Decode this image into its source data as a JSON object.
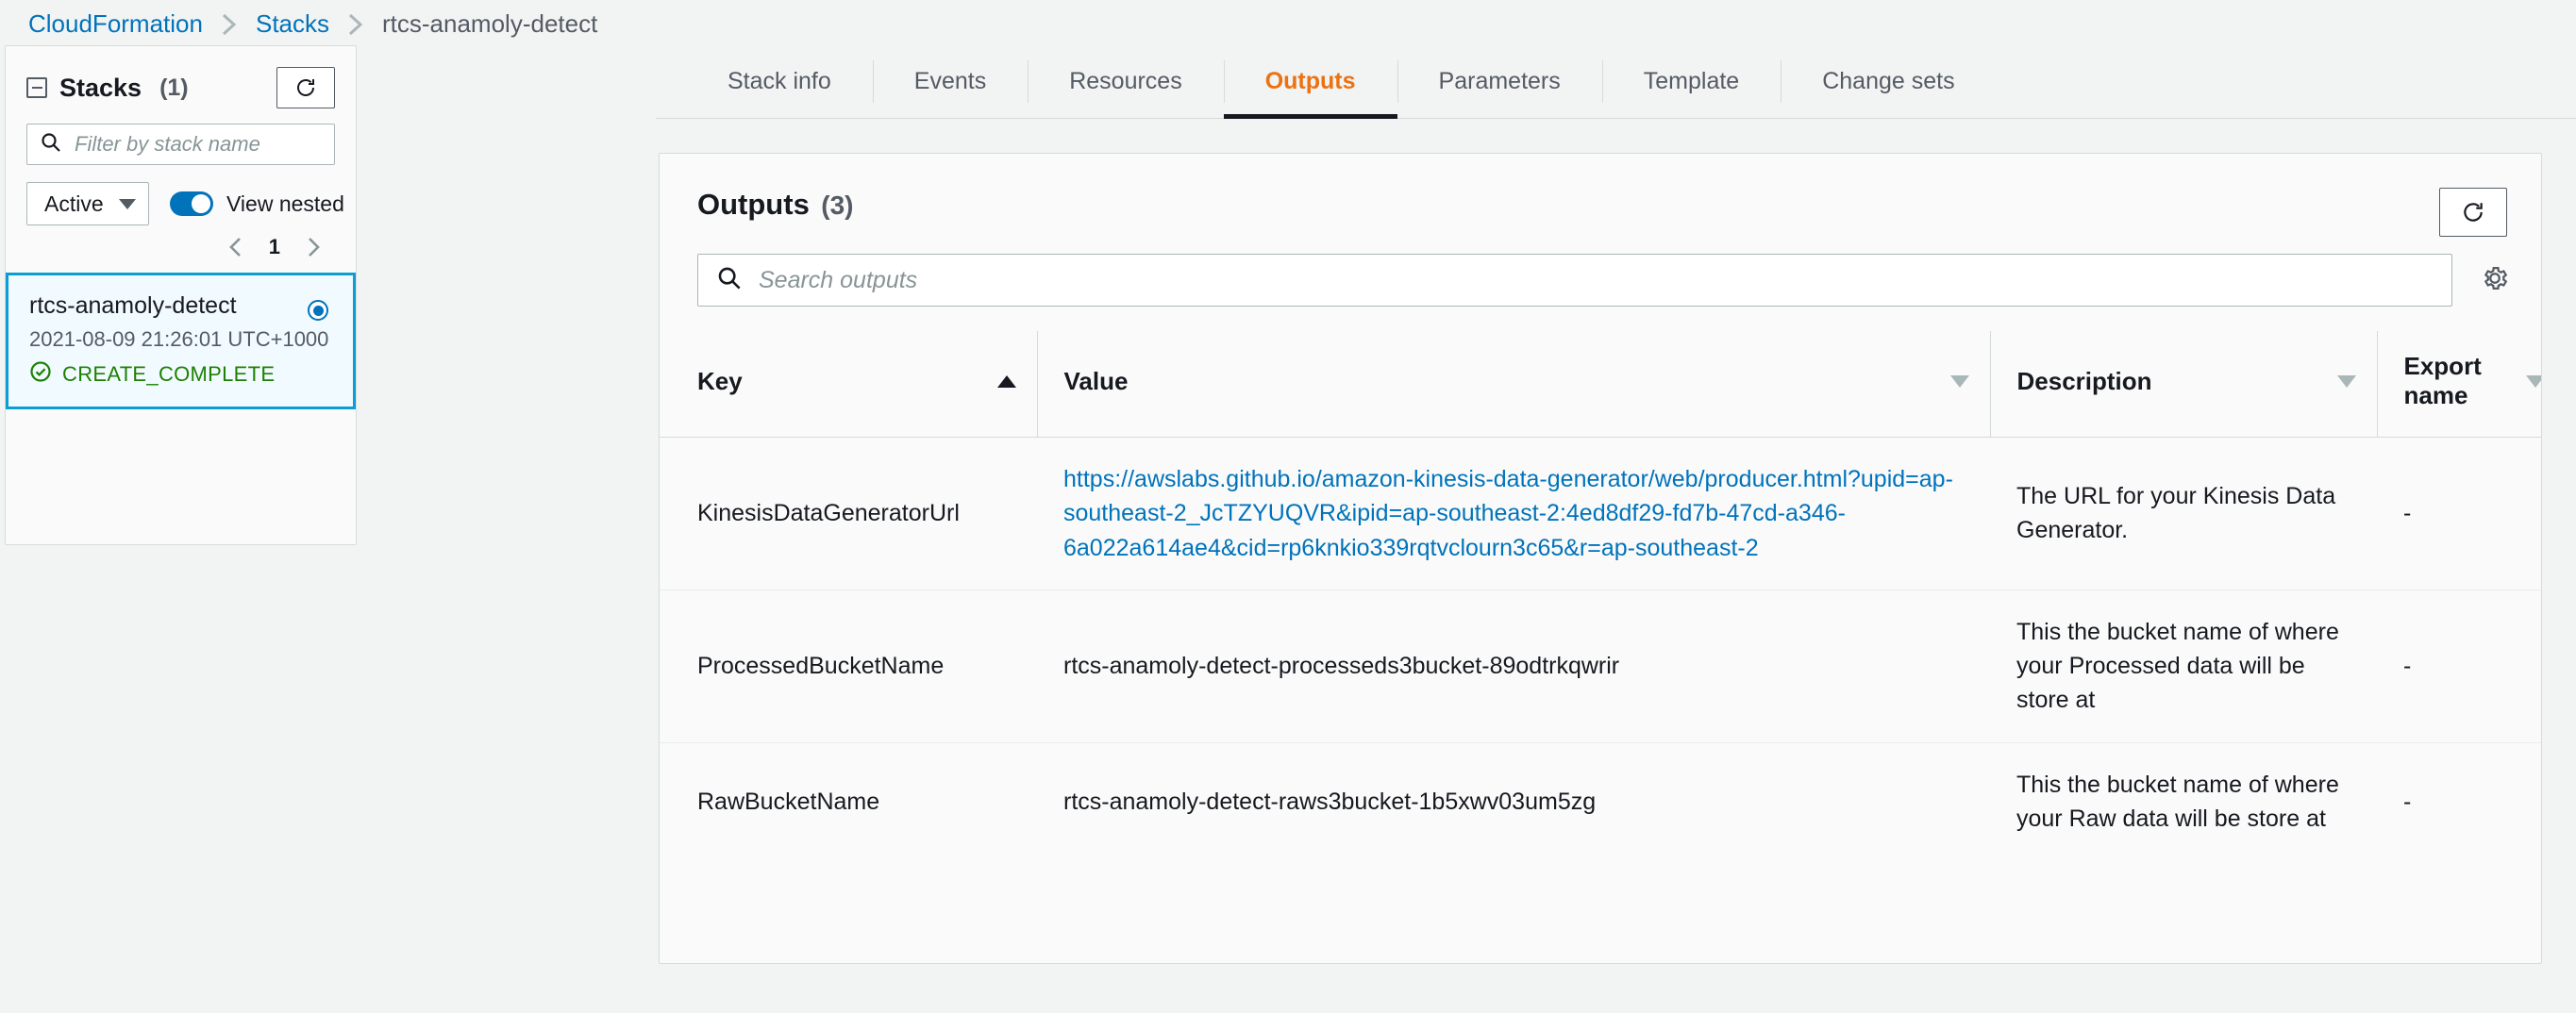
{
  "breadcrumb": {
    "items": [
      {
        "label": "CloudFormation",
        "type": "link"
      },
      {
        "label": "Stacks",
        "type": "link"
      },
      {
        "label": "rtcs-anamoly-detect",
        "type": "current"
      }
    ]
  },
  "sidebar": {
    "title": "Stacks",
    "count": "(1)",
    "collapse_icon": "minus-square-icon",
    "refresh_icon": "refresh-icon",
    "filter": {
      "value": "",
      "placeholder": "Filter by stack name",
      "icon": "search-icon"
    },
    "status_select": {
      "value": "Active",
      "icon": "chevron-down-icon"
    },
    "view_nested": {
      "label": "View nested",
      "enabled": true,
      "accent": "#0073bb"
    },
    "pagination": {
      "prev_icon": "chevron-left-icon",
      "page": "1",
      "next_icon": "chevron-right-icon"
    },
    "stack_card": {
      "name": "rtcs-anamoly-detect",
      "timestamp": "2021-08-09 21:26:01 UTC+1000",
      "status": "CREATE_COMPLETE",
      "status_icon": "check-circle-icon",
      "status_color": "#1d8102",
      "selected": true,
      "border_color": "#0a9ed4",
      "background": "#f1faff"
    }
  },
  "tabs": {
    "items": [
      {
        "label": "Stack info",
        "active": false
      },
      {
        "label": "Events",
        "active": false
      },
      {
        "label": "Resources",
        "active": false
      },
      {
        "label": "Outputs",
        "active": true
      },
      {
        "label": "Parameters",
        "active": false
      },
      {
        "label": "Template",
        "active": false
      },
      {
        "label": "Change sets",
        "active": false
      }
    ],
    "active_color": "#ec7211"
  },
  "outputs_panel": {
    "title": "Outputs",
    "count": "(3)",
    "refresh_icon": "refresh-icon",
    "settings_icon": "gear-icon",
    "search": {
      "value": "",
      "placeholder": "Search outputs",
      "icon": "search-icon"
    },
    "columns": [
      {
        "label": "Key",
        "sort": "asc",
        "sort_icon": "triangle-up-filled-icon"
      },
      {
        "label": "Value",
        "sort": "none",
        "sort_icon": "triangle-down-outline-icon"
      },
      {
        "label": "Description",
        "sort": "none",
        "sort_icon": "triangle-down-outline-icon"
      },
      {
        "label": "Export name",
        "sort": "none",
        "sort_icon": "triangle-down-outline-icon"
      }
    ],
    "rows": [
      {
        "key": "KinesisDataGeneratorUrl",
        "value": "https://awslabs.github.io/amazon-kinesis-data-generator/web/producer.html?upid=ap-southeast-2_JcTZYUQVR&ipid=ap-southeast-2:4ed8df29-fd7b-47cd-a346-6a022a614ae4&cid=rp6knkio339rqtvclourn3c65&r=ap-southeast-2",
        "value_is_link": true,
        "description": "The URL for your Kinesis Data Generator.",
        "export_name": "-"
      },
      {
        "key": "ProcessedBucketName",
        "value": "rtcs-anamoly-detect-processeds3bucket-89odtrkqwrir",
        "value_is_link": false,
        "description": "This the bucket name of where your Processed data will be store at",
        "export_name": "-"
      },
      {
        "key": "RawBucketName",
        "value": "rtcs-anamoly-detect-raws3bucket-1b5xwv03um5zg",
        "value_is_link": false,
        "description": "This the bucket name of where your Raw data will be store at",
        "export_name": "-"
      }
    ]
  }
}
